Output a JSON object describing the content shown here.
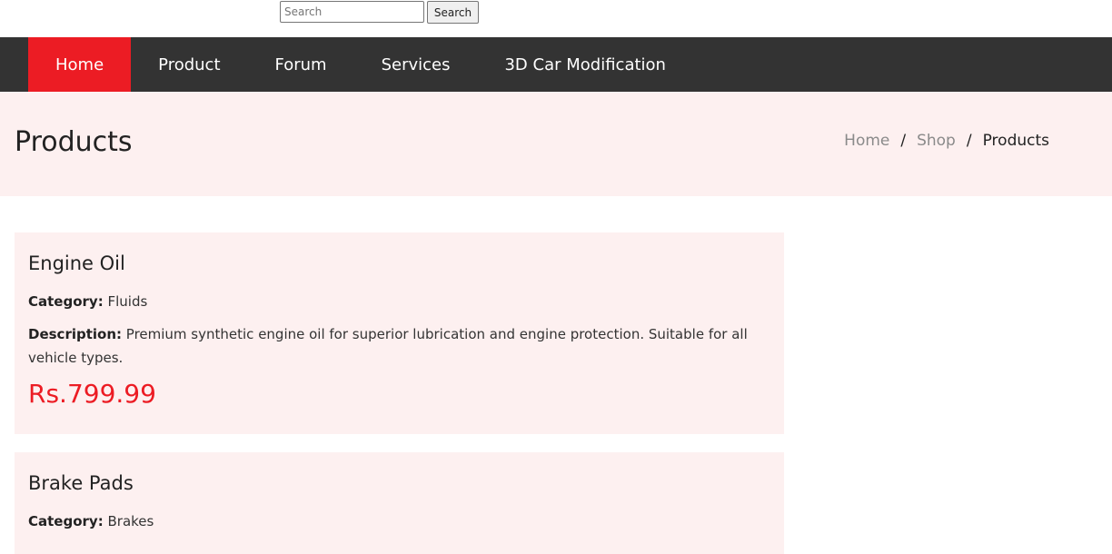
{
  "search": {
    "placeholder": "Search",
    "button_label": "Search"
  },
  "nav": {
    "items": [
      {
        "label": "Home",
        "active": true
      },
      {
        "label": "Product"
      },
      {
        "label": "Forum"
      },
      {
        "label": "Services"
      },
      {
        "label": "3D Car Modification"
      }
    ]
  },
  "hero": {
    "title": "Products",
    "breadcrumb": [
      {
        "label": "Home"
      },
      {
        "label": "Shop"
      },
      {
        "label": "Products"
      }
    ],
    "separator": "/"
  },
  "products": [
    {
      "name": "Engine Oil",
      "category_label": "Category:",
      "category": "Fluids",
      "description_label": "Description:",
      "description": "Premium synthetic engine oil for superior lubrication and engine protection. Suitable for all vehicle types.",
      "price": "Rs.799.99"
    },
    {
      "name": "Brake Pads",
      "category_label": "Category:",
      "category": "Brakes"
    }
  ],
  "colors": {
    "accent": "#ec1c24",
    "navbar": "#333333",
    "hero_bg": "#fdf0f0"
  }
}
